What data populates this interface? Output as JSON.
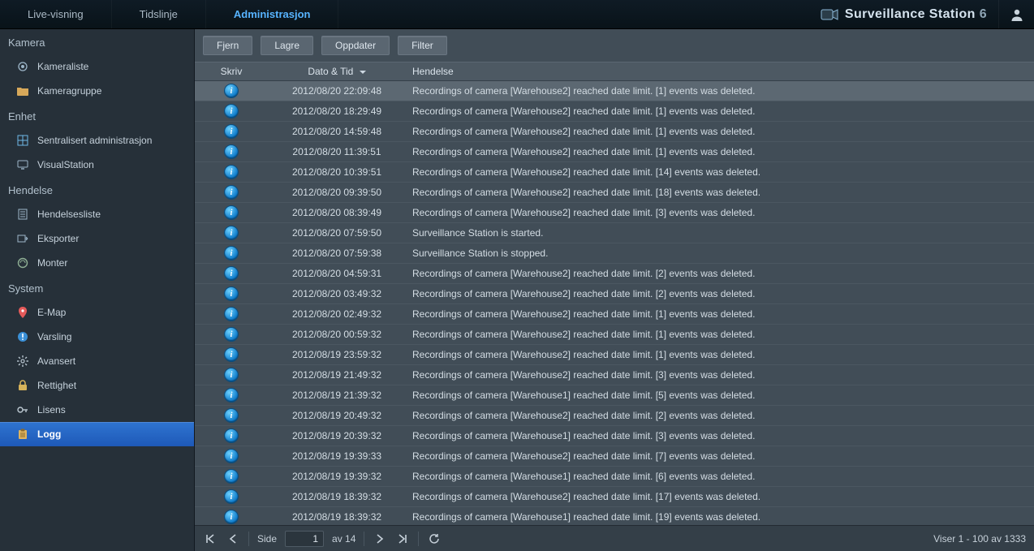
{
  "topbar": {
    "tabs": [
      {
        "label": "Live-visning"
      },
      {
        "label": "Tidslinje"
      },
      {
        "label": "Administrasjon",
        "active": true
      }
    ],
    "brand_name": "Surveillance Station",
    "brand_version": "6"
  },
  "sidebar": {
    "groups": [
      {
        "title": "Kamera",
        "items": [
          {
            "id": "kameraliste",
            "label": "Kameraliste",
            "icon": "camera"
          },
          {
            "id": "kameragruppe",
            "label": "Kameragruppe",
            "icon": "folder"
          }
        ]
      },
      {
        "title": "Enhet",
        "items": [
          {
            "id": "sentral",
            "label": "Sentralisert administrasjon",
            "icon": "grid"
          },
          {
            "id": "visualstation",
            "label": "VisualStation",
            "icon": "monitor"
          }
        ]
      },
      {
        "title": "Hendelse",
        "items": [
          {
            "id": "hendelsesliste",
            "label": "Hendelsesliste",
            "icon": "list"
          },
          {
            "id": "eksporter",
            "label": "Eksporter",
            "icon": "export"
          },
          {
            "id": "monter",
            "label": "Monter",
            "icon": "mount"
          }
        ]
      },
      {
        "title": "System",
        "items": [
          {
            "id": "emap",
            "label": "E-Map",
            "icon": "pin"
          },
          {
            "id": "varsling",
            "label": "Varsling",
            "icon": "alert"
          },
          {
            "id": "avansert",
            "label": "Avansert",
            "icon": "gear"
          },
          {
            "id": "rettighet",
            "label": "Rettighet",
            "icon": "lock"
          },
          {
            "id": "lisens",
            "label": "Lisens",
            "icon": "key"
          },
          {
            "id": "logg",
            "label": "Logg",
            "icon": "clipboard",
            "selected": true
          }
        ]
      }
    ]
  },
  "toolbar": {
    "remove": "Fjern",
    "save": "Lagre",
    "refresh": "Oppdater",
    "filter": "Filter"
  },
  "grid": {
    "columns": {
      "type": "Skriv",
      "datetime": "Dato & Tid",
      "event": "Hendelse"
    },
    "rows": [
      {
        "dt": "2012/08/20 22:09:48",
        "msg": "Recordings of camera [Warehouse2] reached date limit. [1] events was deleted.",
        "selected": true
      },
      {
        "dt": "2012/08/20 18:29:49",
        "msg": "Recordings of camera [Warehouse2] reached date limit. [1] events was deleted."
      },
      {
        "dt": "2012/08/20 14:59:48",
        "msg": "Recordings of camera [Warehouse2] reached date limit. [1] events was deleted."
      },
      {
        "dt": "2012/08/20 11:39:51",
        "msg": "Recordings of camera [Warehouse2] reached date limit. [1] events was deleted."
      },
      {
        "dt": "2012/08/20 10:39:51",
        "msg": "Recordings of camera [Warehouse2] reached date limit. [14] events was deleted."
      },
      {
        "dt": "2012/08/20 09:39:50",
        "msg": "Recordings of camera [Warehouse2] reached date limit. [18] events was deleted."
      },
      {
        "dt": "2012/08/20 08:39:49",
        "msg": "Recordings of camera [Warehouse2] reached date limit. [3] events was deleted."
      },
      {
        "dt": "2012/08/20 07:59:50",
        "msg": "Surveillance Station is started."
      },
      {
        "dt": "2012/08/20 07:59:38",
        "msg": "Surveillance Station is stopped."
      },
      {
        "dt": "2012/08/20 04:59:31",
        "msg": "Recordings of camera [Warehouse2] reached date limit. [2] events was deleted."
      },
      {
        "dt": "2012/08/20 03:49:32",
        "msg": "Recordings of camera [Warehouse2] reached date limit. [2] events was deleted."
      },
      {
        "dt": "2012/08/20 02:49:32",
        "msg": "Recordings of camera [Warehouse2] reached date limit. [1] events was deleted."
      },
      {
        "dt": "2012/08/20 00:59:32",
        "msg": "Recordings of camera [Warehouse2] reached date limit. [1] events was deleted."
      },
      {
        "dt": "2012/08/19 23:59:32",
        "msg": "Recordings of camera [Warehouse2] reached date limit. [1] events was deleted."
      },
      {
        "dt": "2012/08/19 21:49:32",
        "msg": "Recordings of camera [Warehouse2] reached date limit. [3] events was deleted."
      },
      {
        "dt": "2012/08/19 21:39:32",
        "msg": "Recordings of camera [Warehouse1] reached date limit. [5] events was deleted."
      },
      {
        "dt": "2012/08/19 20:49:32",
        "msg": "Recordings of camera [Warehouse2] reached date limit. [2] events was deleted."
      },
      {
        "dt": "2012/08/19 20:39:32",
        "msg": "Recordings of camera [Warehouse1] reached date limit. [3] events was deleted."
      },
      {
        "dt": "2012/08/19 19:39:33",
        "msg": "Recordings of camera [Warehouse2] reached date limit. [7] events was deleted."
      },
      {
        "dt": "2012/08/19 19:39:32",
        "msg": "Recordings of camera [Warehouse1] reached date limit. [6] events was deleted."
      },
      {
        "dt": "2012/08/19 18:39:32",
        "msg": "Recordings of camera [Warehouse2] reached date limit. [17] events was deleted."
      },
      {
        "dt": "2012/08/19 18:39:32",
        "msg": "Recordings of camera [Warehouse1] reached date limit. [19] events was deleted."
      }
    ]
  },
  "pager": {
    "side_label": "Side",
    "page": "1",
    "of_label": "av 14",
    "status": "Viser 1 - 100 av 1333"
  }
}
